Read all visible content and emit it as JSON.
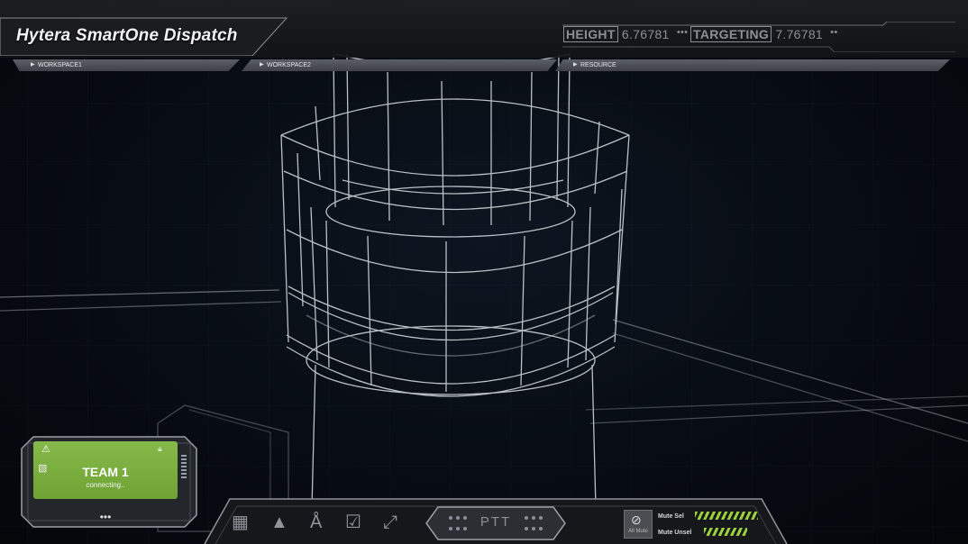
{
  "header": {
    "title": "Hytera SmartOne Dispatch",
    "height_label": "HEIGHT",
    "height_value": "6.76781",
    "height_dots": "•••",
    "targeting_label": "TARGETING",
    "targeting_value": "7.76781",
    "targeting_dots": "••"
  },
  "tabs": [
    {
      "label": "WORKSPACE1"
    },
    {
      "label": "WORKSPACE2"
    },
    {
      "label": "RESOURCE"
    }
  ],
  "team": {
    "name": "TEAM 1",
    "status": "connecting..",
    "more": "•••",
    "status_color": "#7db142"
  },
  "toolbar": {
    "ptt_label": "PTT",
    "all_mute_label": "All Mute",
    "mute_sel_label": "Mute Sel",
    "mute_unsel_label": "Mute Unsel",
    "icons": [
      "keypad-icon",
      "alert-bell-icon",
      "listen-ear-icon",
      "checklist-icon",
      "fullscreen-icon"
    ],
    "accent": "#9bd23a"
  }
}
